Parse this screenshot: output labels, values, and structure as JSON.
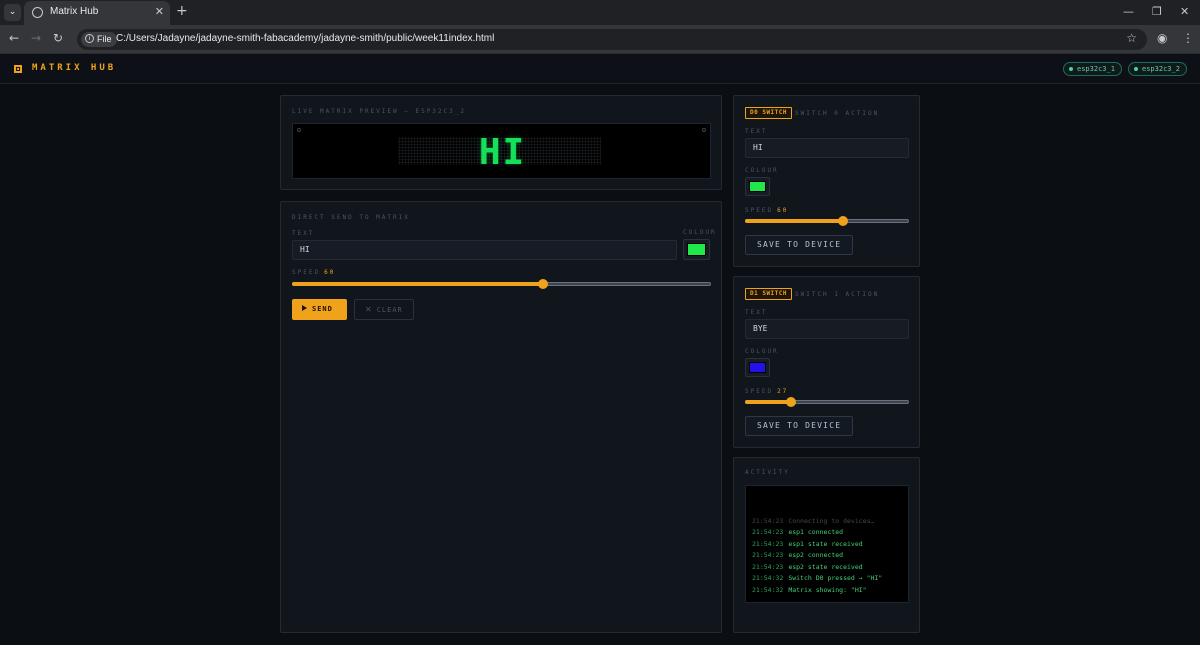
{
  "browser": {
    "tab_title": "Matrix Hub",
    "file_chip": "File",
    "url": "C:/Users/Jadayne/jadayne-smith-fabacademy/jadayne-smith/public/week11index.html"
  },
  "header": {
    "logo": "MATRIX HUB",
    "devices": [
      "esp32c3_1",
      "esp32c3_2"
    ]
  },
  "preview": {
    "label": "LIVE MATRIX PREVIEW — ESP32C3_2",
    "text": "HI"
  },
  "direct": {
    "label": "DIRECT SEND TO MATRIX",
    "text_label": "TEXT",
    "text_value": "HI",
    "colour_label": "COLOUR",
    "colour": "#1fe84a",
    "speed_label": "SPEED",
    "speed": "60",
    "speed_fraction": 0.6,
    "send_label": "SEND",
    "clear_label": "CLEAR"
  },
  "switch0": {
    "badge": "D0 SWITCH",
    "title": "SWITCH 0 ACTION",
    "text_label": "TEXT",
    "text_value": "HI",
    "colour_label": "COLOUR",
    "colour": "#1fe84a",
    "speed_label": "SPEED",
    "speed": "60",
    "speed_fraction": 0.6,
    "save_label": "SAVE TO DEVICE"
  },
  "switch1": {
    "badge": "D1 SWITCH",
    "title": "SWITCH 1 ACTION",
    "text_label": "TEXT",
    "text_value": "BYE",
    "colour_label": "COLOUR",
    "colour": "#2211e8",
    "speed_label": "SPEED",
    "speed": "27",
    "speed_fraction": 0.28,
    "save_label": "SAVE TO DEVICE"
  },
  "activity": {
    "label": "ACTIVITY",
    "lines": [
      {
        "time": "21:54:23",
        "msg": "Connecting to devices…",
        "dim": true
      },
      {
        "time": "21:54:23",
        "msg": "esp1 connected",
        "dim": false
      },
      {
        "time": "21:54:23",
        "msg": "esp1 state received",
        "dim": false
      },
      {
        "time": "21:54:23",
        "msg": "esp2 connected",
        "dim": false
      },
      {
        "time": "21:54:23",
        "msg": "esp2 state received",
        "dim": false
      },
      {
        "time": "21:54:32",
        "msg": "Switch D0 pressed → \"HI\"",
        "dim": false
      },
      {
        "time": "21:54:32",
        "msg": "Matrix showing: \"HI\"",
        "dim": false
      }
    ]
  }
}
